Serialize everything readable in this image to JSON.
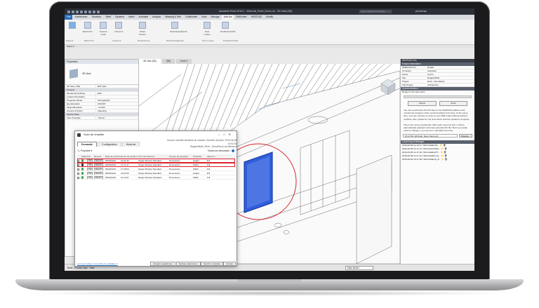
{
  "titlebar": {
    "title": "Autodesk Revit 2019.2 - WizzLab_Revit_Demo.rvt - 3D View {3D}",
    "search_placeholder": "Type a keyword or phrase",
    "user": "pscdenap"
  },
  "ribbon": {
    "tabs": [
      "File",
      "Architecture",
      "Structure",
      "Steel",
      "Systems",
      "Insert",
      "Annotate",
      "Analyze",
      "Massing & Site",
      "Collaborate",
      "View",
      "Manage",
      "Add-Ins",
      "BIMLinker",
      "WIZZCAD",
      "Modify"
    ],
    "active_tab": "Add-Ins",
    "buttons": [
      "Batch Print",
      "Transmit model",
      "eTransmit",
      "Model Review",
      "WorksharingMonitor",
      "Revit Lookup",
      "RevitPythonShell"
    ],
    "panels": [
      "External",
      "Batch Print",
      "eTransmit",
      "Model Review",
      "WorksharingMonitor",
      "Revit Lookup",
      "RevitPythonShell"
    ],
    "select_label": "Select ▾"
  },
  "properties": {
    "title": "Properties",
    "type_name": "3D View",
    "selector": "3D View: {3D}",
    "edit_type": "Edit Type",
    "rows": [
      {
        "k": "Camera",
        "v": "",
        "section": true
      },
      {
        "k": "Rendering Settings",
        "v": "Edit..."
      },
      {
        "k": "Locked Orientation",
        "v": ""
      },
      {
        "k": "Projection Mode",
        "v": "Orthographic"
      },
      {
        "k": "Eye Elevation",
        "v": "20.6318"
      },
      {
        "k": "Target Elevation",
        "v": "-4.3345"
      },
      {
        "k": "Camera Position",
        "v": "Adjusting"
      },
      {
        "k": "Identity Data",
        "v": "",
        "section": true
      },
      {
        "k": "View Template",
        "v": "<None>"
      }
    ]
  },
  "view_tabs": [
    "3D View {3D}",
    "{3D}",
    "Level 1"
  ],
  "statusbar": {
    "text": "Revit - Precast Clips · Start",
    "combo": "Main Model"
  },
  "wizzcad": {
    "title": "WIZZCAD Info",
    "project_section": "Project Information",
    "project_rows": [
      {
        "k": "WIZZCAD Info",
        "v": "Details"
      },
      {
        "k": "Company",
        "v": "Autodesk"
      },
      {
        "k": "Name",
        "v": "Cyrrus"
      },
      {
        "k": "Site",
        "v": "RegisterBuilt"
      },
      {
        "k": "Project",
        "v": "Revit - DemoRevit"
      },
      {
        "k": "Sub Project",
        "v": "Architecture"
      }
    ],
    "sync_section": "Synchronization",
    "sync_status": "Ready for the Next Sync.",
    "cancel": "Cancel",
    "send": "Send",
    "sync_text": "You can synchronize the IFC files to the WIZZCAD platform and monitor the progress of the synchronization from here. At the same time, you can continue to work on your BIM model without causing conflicts. Also, please do not close Revit until the upload is complete.",
    "current_text": "This is the current upload file. After each export of IFC, it will be automatically updated to the last exported IFC file. But if you really need to change it, you can do it manually from here.",
    "file_value": "15-17-59_WizzLab_Revit_Demo.ifc",
    "browse": "Browse...",
    "local_section": "Local Export Manager",
    "files": [
      "2019-06-05 11-16-17  |  WizzLabMCH4...",
      "2019-06-05 11-17-11  |  WizzLabCFNOS...",
      "2019-06-05 11-17-32  |  WizzLabECATT...",
      "2019-06-05 11-27-11  |  WizzLabRevit_E...",
      "2019-06-05 15-17-59  |  WizzLabRevit_E..."
    ]
  },
  "dialog": {
    "title": "Suivi du chantier",
    "info_line1": "Aucune nouvelle demande du chantier. Dernière Synchro: 2019-06-06 14:52:40",
    "info_line2": "RegisterBuilt  |  Revit - DemoRevit  |  Architecture",
    "tabs": [
      "Demande",
      "Configuration",
      "WizzLab"
    ],
    "filter": "Propriété",
    "all_requests": "Toutes les demandes",
    "columns": [
      "",
      "Statut",
      "Voir",
      "Revenir",
      "Date de synchro",
      "Heure de synchro",
      "Nom de l'élément",
      "Groupe de propriété",
      "Propriété",
      "Valeur d..."
    ],
    "rows": [
      {
        "status": "green",
        "date": "05/06/2019",
        "time": "16:31:46",
        "element": "Single Window Standard",
        "group": "Dimensions",
        "prop": "Height",
        "val": "2.7"
      },
      {
        "status": "black",
        "date": "06/06/2019",
        "time": "17:27:47",
        "element": "Single Window Standard",
        "group": "Dimensions",
        "prop": "Width",
        "val": "1.2"
      },
      {
        "status": "green",
        "date": "06/06/2019",
        "time": "17:28:54",
        "element": "Single Window Standard",
        "group": "Dimensions",
        "prop": "Width",
        "val": "1.5"
      },
      {
        "status": "green",
        "date": "06/06/2019",
        "time": "10:03:53",
        "element": "Single Window Standard",
        "group": "Dimensions",
        "prop": "Height",
        "val": "2.7"
      },
      {
        "status": "green",
        "date": "06/06/2019",
        "time": "14:12:27",
        "element": "Single Window Standard",
        "group": "Dimensions",
        "prop": "Width",
        "val": "1.2"
      }
    ],
    "see": "Voir",
    "revert": "Revenir",
    "link": "Comment piloter votre tâche de validation ?",
    "buttons": [
      "Accepter sélectionné",
      "Refuser sélectionné",
      "Synchro complète",
      "Annuler"
    ]
  },
  "colors": {
    "accent": "#2a6fbf",
    "highlight": "#d9232d",
    "window_glass": "#2f5fdb"
  }
}
